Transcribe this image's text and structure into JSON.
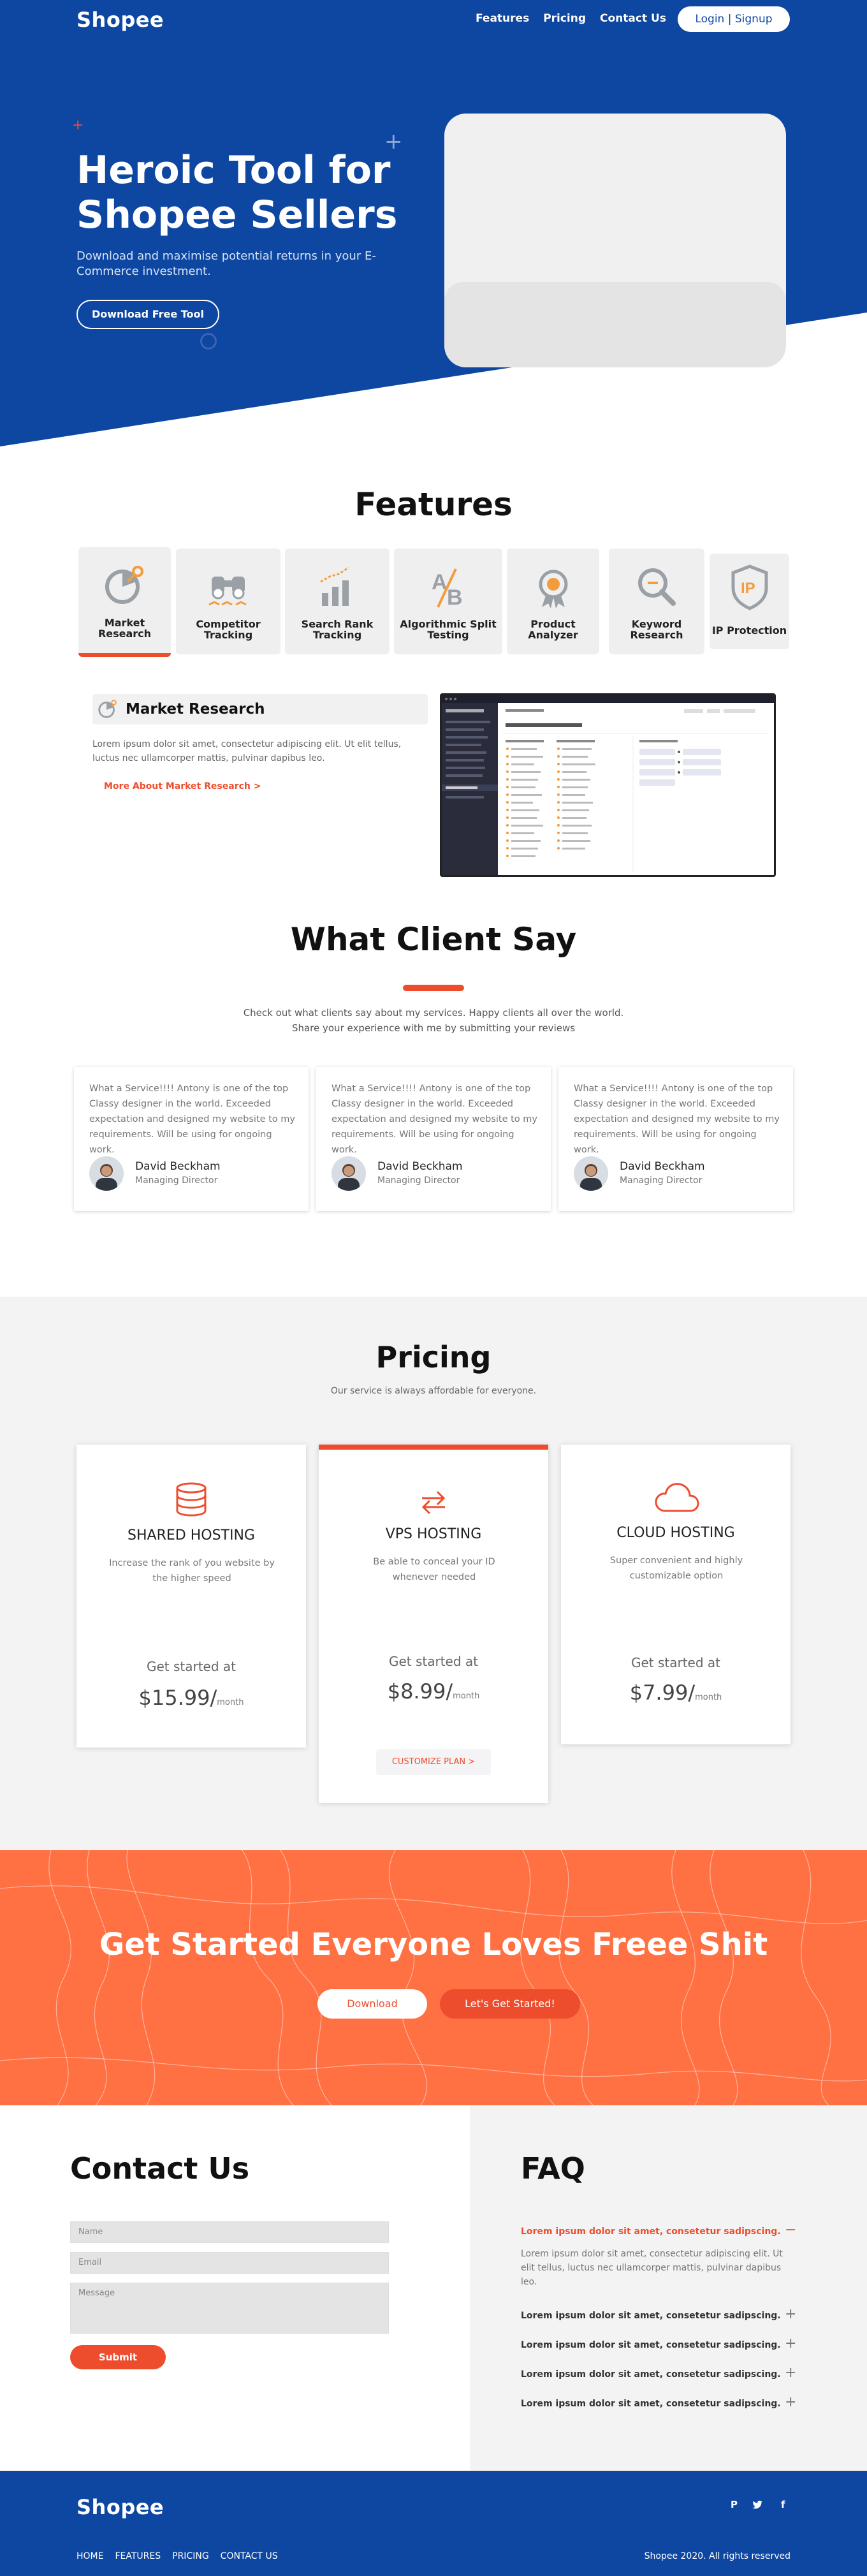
{
  "brand": {
    "name": "Shopee",
    "primary_color": "#0d47a1",
    "accent_color": "#ee4d2d",
    "cta_color": "#ff7043"
  },
  "nav": {
    "links": [
      "Features",
      "Pricing",
      "Contact Us"
    ],
    "login_label": "Login | Signup"
  },
  "hero": {
    "title": "Heroic Tool for Shopee Sellers",
    "subtitle": "Download and maximise potential returns in your E-Commerce investment.",
    "button": "Download Free Tool"
  },
  "features": {
    "title": "Features",
    "items": [
      {
        "label": "Market Research",
        "icon": "market-research-icon",
        "active": true
      },
      {
        "label": "Competitor Tracking",
        "icon": "binoculars-icon"
      },
      {
        "label": "Search Rank Tracking",
        "icon": "bar-chart-icon"
      },
      {
        "label": "Algorithmic Split Testing",
        "icon": "ab-test-icon"
      },
      {
        "label": "Product Analyzer",
        "icon": "award-icon"
      },
      {
        "label": "Keyword Research",
        "icon": "magnifier-icon"
      },
      {
        "label": "IP Protection",
        "icon": "ip-shield-icon"
      }
    ],
    "detail": {
      "title": "Market Research",
      "description": "Lorem ipsum dolor sit amet, consectetur adipiscing elit. Ut elit tellus, luctus nec ullamcorper mattis, pulvinar dapibus leo.",
      "link": "More About Market Research >"
    }
  },
  "testimonials": {
    "title": "What Client Say",
    "subtitle": "Check out what clients say about my services. Happy clients all over the world. Share your experience with me by submitting your reviews",
    "items": [
      {
        "quote": "What a Service!!!! Antony is one of the top Classy designer in the world. Exceeded expectation and designed my website to my requirements. Will be using for ongoing work.",
        "name": "David Beckham",
        "role": "Managing Director"
      },
      {
        "quote": "What a Service!!!! Antony is one of the top Classy designer in the world. Exceeded expectation and designed my website to my requirements. Will be using for ongoing work.",
        "name": "David Beckham",
        "role": "Managing Director"
      },
      {
        "quote": "What a Service!!!! Antony is one of the top Classy designer in the world. Exceeded expectation and designed my website to my requirements. Will be using for ongoing work.",
        "name": "David Beckham",
        "role": "Managing Director"
      }
    ]
  },
  "pricing": {
    "title": "Pricing",
    "subtitle": "Our service is always affordable for everyone.",
    "plans": [
      {
        "name": "SHARED HOSTING",
        "icon": "database-icon",
        "description": "Increase the rank of you website by the higher speed",
        "started": "Get started at",
        "price": "$15.99/",
        "unit": "month"
      },
      {
        "name": "VPS HOSTING",
        "icon": "exchange-icon",
        "description": "Be able to conceal your ID whenever needed",
        "started": "Get started at",
        "price": "$8.99/",
        "unit": "month",
        "button": "CUSTOMIZE PLAN >",
        "featured": true
      },
      {
        "name": "CLOUD HOSTING",
        "icon": "cloud-icon",
        "description": "Super convenient and highly customizable option",
        "started": "Get started at",
        "price": "$7.99/",
        "unit": "month"
      }
    ]
  },
  "cta": {
    "title": "Get Started Everyone Loves Freee Shit",
    "download": "Download",
    "start": "Let's Get Started!"
  },
  "contact": {
    "title": "Contact Us",
    "name_placeholder": "Name",
    "email_placeholder": "Email",
    "message_placeholder": "Message",
    "submit": "Submit"
  },
  "faq": {
    "title": "FAQ",
    "items": [
      {
        "q": "Lorem ipsum dolor sit amet, consetetur sadipscing.",
        "a": "Lorem ipsum dolor sit amet, consectetur adipiscing elit. Ut elit tellus, luctus nec ullamcorper mattis, pulvinar dapibus leo.",
        "open": true
      },
      {
        "q": "Lorem ipsum dolor sit amet, consetetur sadipscing."
      },
      {
        "q": "Lorem ipsum dolor sit amet, consetetur sadipscing."
      },
      {
        "q": "Lorem ipsum dolor sit amet, consetetur sadipscing."
      },
      {
        "q": "Lorem ipsum dolor sit amet, consetetur sadipscing."
      }
    ]
  },
  "footer": {
    "logo": "Shopee",
    "links": [
      "HOME",
      "FEATURES",
      "PRICING",
      "CONTACT US"
    ],
    "copyright": "Shopee 2020. All rights reserved",
    "social": [
      "pinterest-icon",
      "twitter-icon",
      "facebook-icon"
    ]
  }
}
